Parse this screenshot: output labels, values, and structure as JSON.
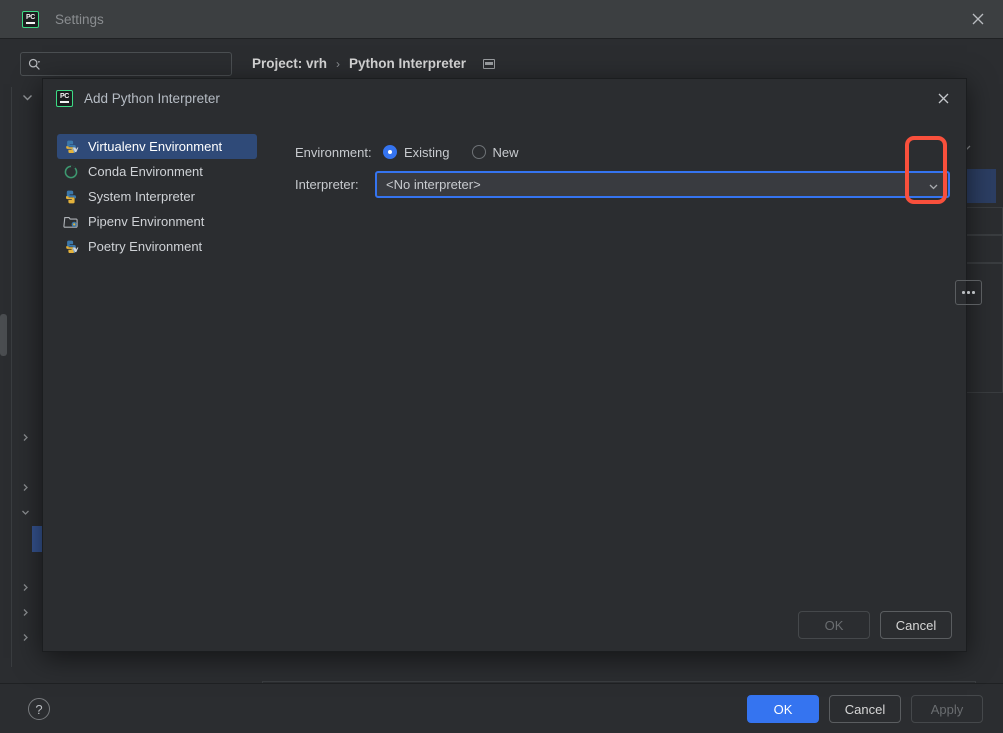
{
  "settings_window": {
    "title": "Settings",
    "logo_text": "PC",
    "close_icon": "close-icon",
    "search": {
      "placeholder": "",
      "value": "",
      "icon": "search-icon"
    },
    "breadcrumb": {
      "project": "Project: vrh",
      "separator": "›",
      "current": "Python Interpreter",
      "trailing_icon": "panel-layout-icon"
    },
    "nav": {
      "back_icon": "arrow-left-icon",
      "forward_icon": "arrow-right-icon"
    },
    "footer": {
      "help_label": "?",
      "ok_label": "OK",
      "cancel_label": "Cancel",
      "apply_label": "Apply"
    }
  },
  "dialog": {
    "title": "Add Python Interpreter",
    "logo_text": "PC",
    "close_icon": "close-icon",
    "expander_icon": "chevron-down-icon",
    "environments": [
      {
        "label": "Virtualenv Environment",
        "icon": "virtualenv-icon",
        "selected": true
      },
      {
        "label": "Conda Environment",
        "icon": "conda-icon",
        "selected": false
      },
      {
        "label": "System Interpreter",
        "icon": "python-icon",
        "selected": false
      },
      {
        "label": "Pipenv Environment",
        "icon": "pipenv-icon",
        "selected": false
      },
      {
        "label": "Poetry Environment",
        "icon": "poetry-icon",
        "selected": false
      }
    ],
    "form": {
      "environment_label": "Environment:",
      "radio_existing": "Existing",
      "radio_new": "New",
      "selected_radio": "Existing",
      "interpreter_label": "Interpreter:",
      "interpreter_value": "<No interpreter>",
      "interpreter_arrow_icon": "chevron-down-icon",
      "browse_button_label": "...",
      "browse_button_icon": "ellipsis-icon"
    },
    "footer": {
      "ok_label": "OK",
      "cancel_label": "Cancel"
    }
  },
  "colors": {
    "accent_blue": "#3574f0",
    "highlight_red": "#f9503c",
    "selection_blue": "#2f4a78",
    "tree_selection": "#35538f",
    "background": "#2b2d30",
    "titlebar": "#3c3f41"
  }
}
